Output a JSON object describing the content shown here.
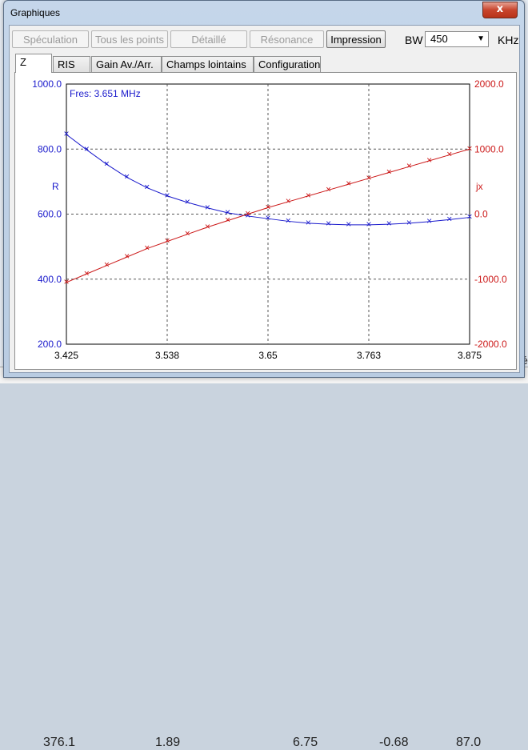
{
  "window": {
    "title": "Graphiques",
    "close_label": "x"
  },
  "toolbar": {
    "buttons": [
      {
        "label": "Spéculation",
        "enabled": false
      },
      {
        "label": "Tous les points",
        "enabled": false
      },
      {
        "label": "Détaillé",
        "enabled": false
      },
      {
        "label": "Résonance",
        "enabled": false
      },
      {
        "label": "Impression",
        "enabled": true
      }
    ],
    "bw_label": "BW",
    "bw_value": "450",
    "khz_label": "KHz"
  },
  "tabs": [
    {
      "label": "Z",
      "selected": true
    },
    {
      "label": "RIS",
      "selected": false
    },
    {
      "label": "Gain Av./Arr.",
      "selected": false
    },
    {
      "label": "Champs lointains",
      "selected": false
    },
    {
      "label": "Configuration",
      "selected": false
    }
  ],
  "background": {
    "row_values": [
      "376.1",
      "1.89",
      "6.75",
      "-0.68",
      "87.0"
    ],
    "right_edge_text": "Ré"
  },
  "chart_data": {
    "type": "line",
    "annotation": "Fres: 3.651 MHz",
    "x_ticks": [
      "3.425",
      "3.538",
      "3.65",
      "3.763",
      "3.875"
    ],
    "xlim": [
      3.425,
      3.875
    ],
    "y_left": {
      "label": "R",
      "ticks": [
        "1000.0",
        "800.0",
        "600.0",
        "400.0",
        "200.0"
      ],
      "lim": [
        200,
        1000
      ],
      "color": "#1a1acc"
    },
    "y_right": {
      "label": "jx",
      "ticks": [
        "2000.0",
        "1000.0",
        "0.0",
        "-1000.0",
        "-2000.0"
      ],
      "lim": [
        -2000,
        2000
      ],
      "color": "#cc1a1a"
    },
    "grid": true,
    "x": [
      3.425,
      3.4475,
      3.47,
      3.4925,
      3.515,
      3.5375,
      3.56,
      3.5825,
      3.605,
      3.6275,
      3.65,
      3.6725,
      3.695,
      3.7175,
      3.74,
      3.7625,
      3.785,
      3.8075,
      3.83,
      3.8525,
      3.875
    ],
    "series": [
      {
        "name": "R",
        "axis": "left",
        "values": [
          845,
          798,
          753,
          713,
          681,
          656,
          636,
          619,
          604,
          594,
          586,
          578,
          572,
          569,
          567,
          567,
          569,
          572,
          577,
          583,
          590
        ]
      },
      {
        "name": "jx",
        "axis": "right",
        "values": [
          -1050,
          -920,
          -790,
          -660,
          -530,
          -420,
          -310,
          -200,
          -100,
          0,
          100,
          190,
          280,
          370,
          460,
          550,
          640,
          730,
          820,
          910,
          1000
        ]
      }
    ]
  }
}
